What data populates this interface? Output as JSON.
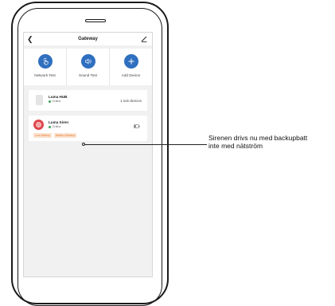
{
  "header": {
    "title": "Gateway",
    "back_icon": "chevron-left-icon",
    "edit_icon": "pencil-icon"
  },
  "actions": [
    {
      "label": "Network Test",
      "icon": "hand-tap-icon"
    },
    {
      "label": "Sound Test",
      "icon": "speaker-icon"
    },
    {
      "label": "Add Device",
      "icon": "plus-icon"
    }
  ],
  "devices": [
    {
      "name": "Luma HUB",
      "status": "Online",
      "meta": "1 sub devices"
    },
    {
      "name": "Luma Siren",
      "status": "Online",
      "tags": [
        "Low Battery",
        "Battery Backup"
      ]
    }
  ],
  "colors": {
    "accent": "#2f6fbf",
    "online": "#3aa55c",
    "siren": "#e0464a",
    "warning_text": "#e6803a",
    "warning_bg": "#fbe3cf"
  },
  "annotation": {
    "line1": "Sirenen drivs nu med backupbatt",
    "line2": "inte med nätström"
  }
}
